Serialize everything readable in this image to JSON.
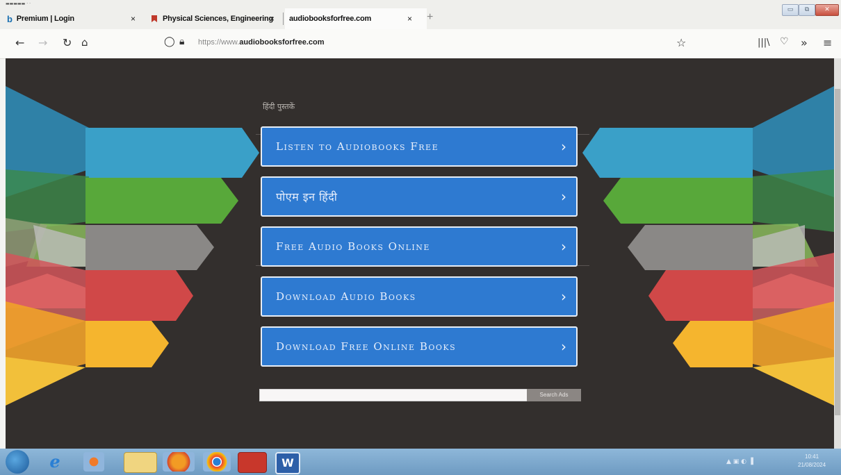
{
  "browser": {
    "tabs": [
      {
        "label": "Premium | Login",
        "close": "×"
      },
      {
        "label": "Physical Sciences, Engineering",
        "close": "×"
      },
      {
        "label": "audiobooksforfree.com",
        "close": "×"
      }
    ],
    "new_tab": "+",
    "url_prefix": "https://www.",
    "url_domain": "audiobooksforfree.com",
    "nav_icons": [
      "back-icon",
      "forward-icon",
      "reload-icon",
      "home-icon",
      "shield-icon",
      "lock-icon",
      "star-icon",
      "library-icon",
      "pocket-icon",
      "overflow-icon",
      "menu-icon"
    ]
  },
  "page": {
    "subtitle": "हिंदी पुस्तकें",
    "menu": [
      {
        "label": "Listen to Audiobooks Free",
        "chevron": "›"
      },
      {
        "label": "पोएम इन हिंदी",
        "chevron": "›"
      },
      {
        "label": "Free Audio Books Online",
        "chevron": "›"
      },
      {
        "label": "Download Audio Books",
        "chevron": "›"
      },
      {
        "label": "Download Free Online Books",
        "chevron": "›"
      }
    ],
    "search_button": "Search Ads",
    "colors": {
      "button": "#2e7ad1",
      "background": "#332f2d",
      "ribbon_blue": "#3aa0c8",
      "ribbon_green": "#58a83a",
      "ribbon_gray": "#8a8886",
      "ribbon_red": "#d04848",
      "ribbon_yellow": "#f5b52e"
    }
  },
  "taskbar": {
    "icons": [
      "windows-start-icon",
      "internet-explorer-icon",
      "media-player-icon",
      "file-explorer-icon",
      "firefox-icon",
      "chrome-icon",
      "acrobat-icon",
      "word-icon"
    ],
    "clock_time": "10:41",
    "clock_date": "21/08/2024"
  }
}
